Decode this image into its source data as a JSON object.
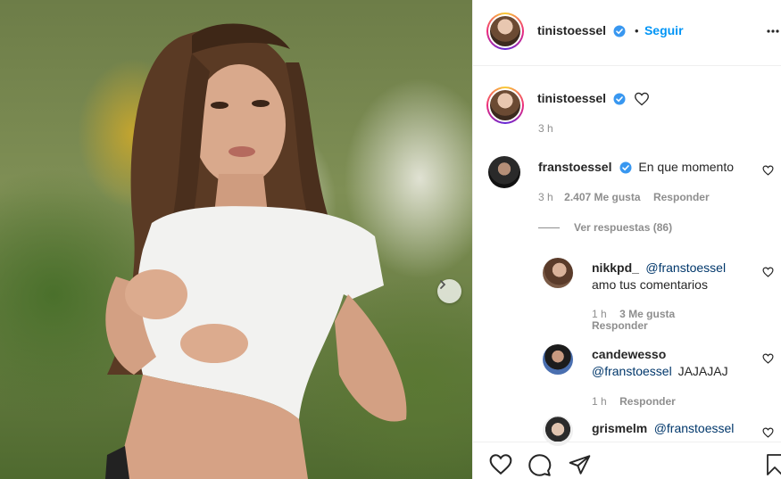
{
  "header": {
    "username": "tinistoessel",
    "separator": "•",
    "follow_label": "Seguir",
    "more_icon": "more-dots-icon"
  },
  "caption": {
    "username": "tinistoessel",
    "time": "3 h",
    "icon": "heart-outline-icon"
  },
  "comments": [
    {
      "username": "franstoessel",
      "text": "En que momento",
      "time": "3 h",
      "likes": "2.407 Me gusta",
      "reply_label": "Responder",
      "view_replies": "Ver respuestas (86)"
    }
  ],
  "replies": [
    {
      "username": "nikkpd_",
      "mention": "@franstoessel",
      "text": "amo tus comentarios",
      "time": "1 h",
      "likes": "3 Me gusta",
      "reply_label": "Responder"
    },
    {
      "username": "candewesso",
      "mention": "@franstoessel",
      "text": "JAJAJAJ",
      "time": "1 h",
      "reply_label": "Responder"
    },
    {
      "username": "grismelm",
      "mention": "@franstoessel"
    }
  ],
  "colors": {
    "accent_blue": "#0095f6",
    "verified_blue": "#3897f0",
    "mention_blue": "#00376b",
    "muted": "#8e8e8e"
  }
}
